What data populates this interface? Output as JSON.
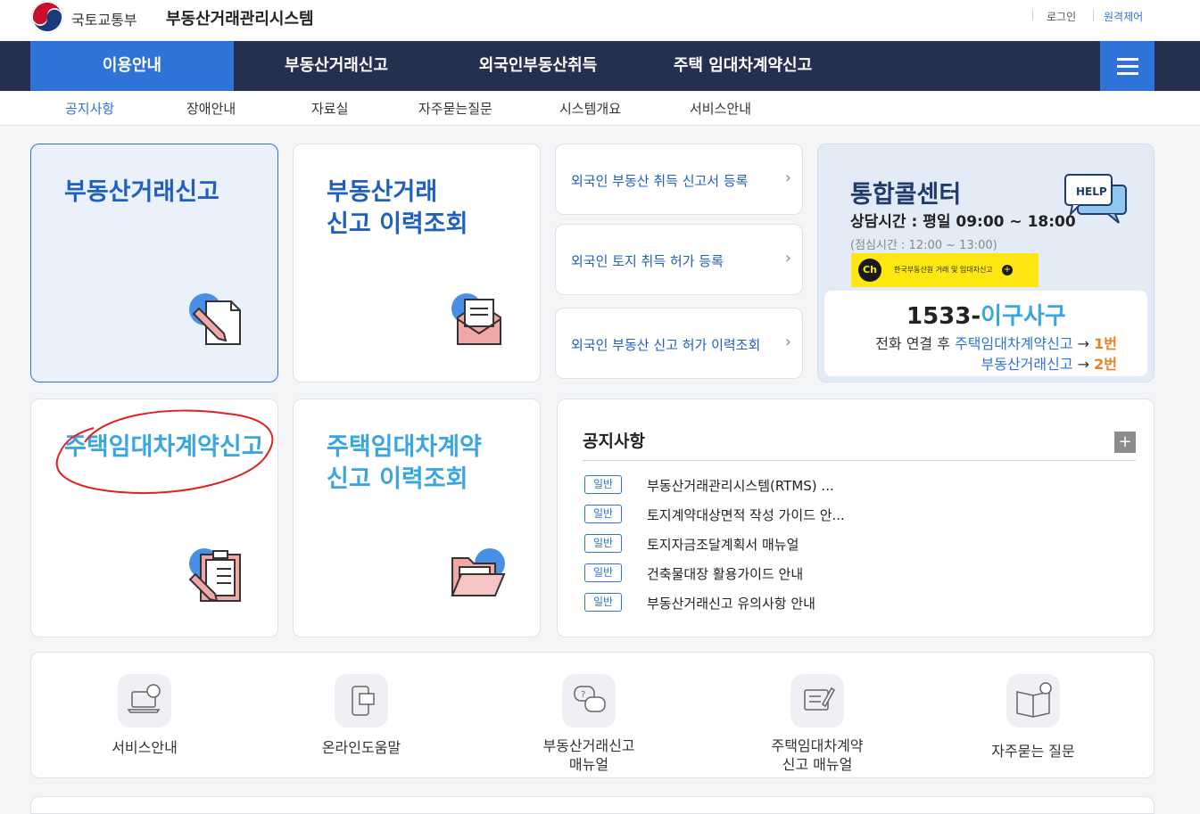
{
  "header": {
    "ministry": "국토교통부",
    "system_title": "부동산거래관리시스템",
    "login": "로그인",
    "remote": "원격제어"
  },
  "gnb": {
    "items": [
      "이용안내",
      "부동산거래신고",
      "외국인부동산취득",
      "주택 임대차계약신고"
    ]
  },
  "lnb": {
    "items": [
      "공지사항",
      "장애안내",
      "자료실",
      "자주묻는질문",
      "시스템개요",
      "서비스안내"
    ]
  },
  "cards": {
    "report": "부동산거래신고",
    "history_line1": "부동산거래",
    "history_line2": "신고 이력조회",
    "lease": "주택임대차계약신고",
    "lease_history_line1": "주택임대차계약",
    "lease_history_line2": "신고 이력조회"
  },
  "foreign_links": [
    "외국인 부동산 취득 신고서 등록",
    "외국인 토지 취득 허가 등록",
    "외국인 부동산 신고 허가 이력조회"
  ],
  "callcenter": {
    "title": "통합콜센터",
    "hours": "상담시간 : 평일 09:00 ~ 18:00",
    "lunch": "(점심시간 : 12:00 ~ 13:00)",
    "help": "HELP",
    "kakao_logo": "Ch",
    "kakao_text": "한국부동산원 거래 및 임대차신고",
    "number_prefix": "1533-",
    "number_suffix": "이구사구",
    "line1_pre": "전화 연결 후",
    "line1_svc": "주택임대차계약신고",
    "line1_arrow": "→",
    "line1_num": "1번",
    "line2_svc": "부동산거래신고",
    "line2_arrow": "→",
    "line2_num": "2번"
  },
  "notice": {
    "title": "공지사항",
    "more": "+",
    "items": [
      {
        "badge": "일반",
        "text": "부동산거래관리시스템(RTMS) ..."
      },
      {
        "badge": "일반",
        "text": "토지계약대상면적 작성 가이드 안..."
      },
      {
        "badge": "일반",
        "text": "토지자금조달계획서 매뉴얼"
      },
      {
        "badge": "일반",
        "text": "건축물대장 활용가이드 안내"
      },
      {
        "badge": "일반",
        "text": "부동산거래신고 유의사항 안내"
      }
    ]
  },
  "services": [
    {
      "label": "서비스안내",
      "icon": "laptop-chat-icon"
    },
    {
      "label": "온라인도움말",
      "icon": "phone-document-icon"
    },
    {
      "label": "부동산거래신고\n매뉴얼",
      "icon": "question-chat-icon"
    },
    {
      "label": "주택임대차계약\n신고 매뉴얼",
      "icon": "edit-document-icon"
    },
    {
      "label": "자주묻는 질문",
      "icon": "open-book-info-icon"
    }
  ],
  "colors": {
    "nav_bg": "#253050",
    "accent": "#2f73d9",
    "title_dark_blue": "#1f5fbf",
    "title_light_blue": "#3aa6e0",
    "orange": "#e8801f",
    "annotation_red": "#e02020"
  }
}
